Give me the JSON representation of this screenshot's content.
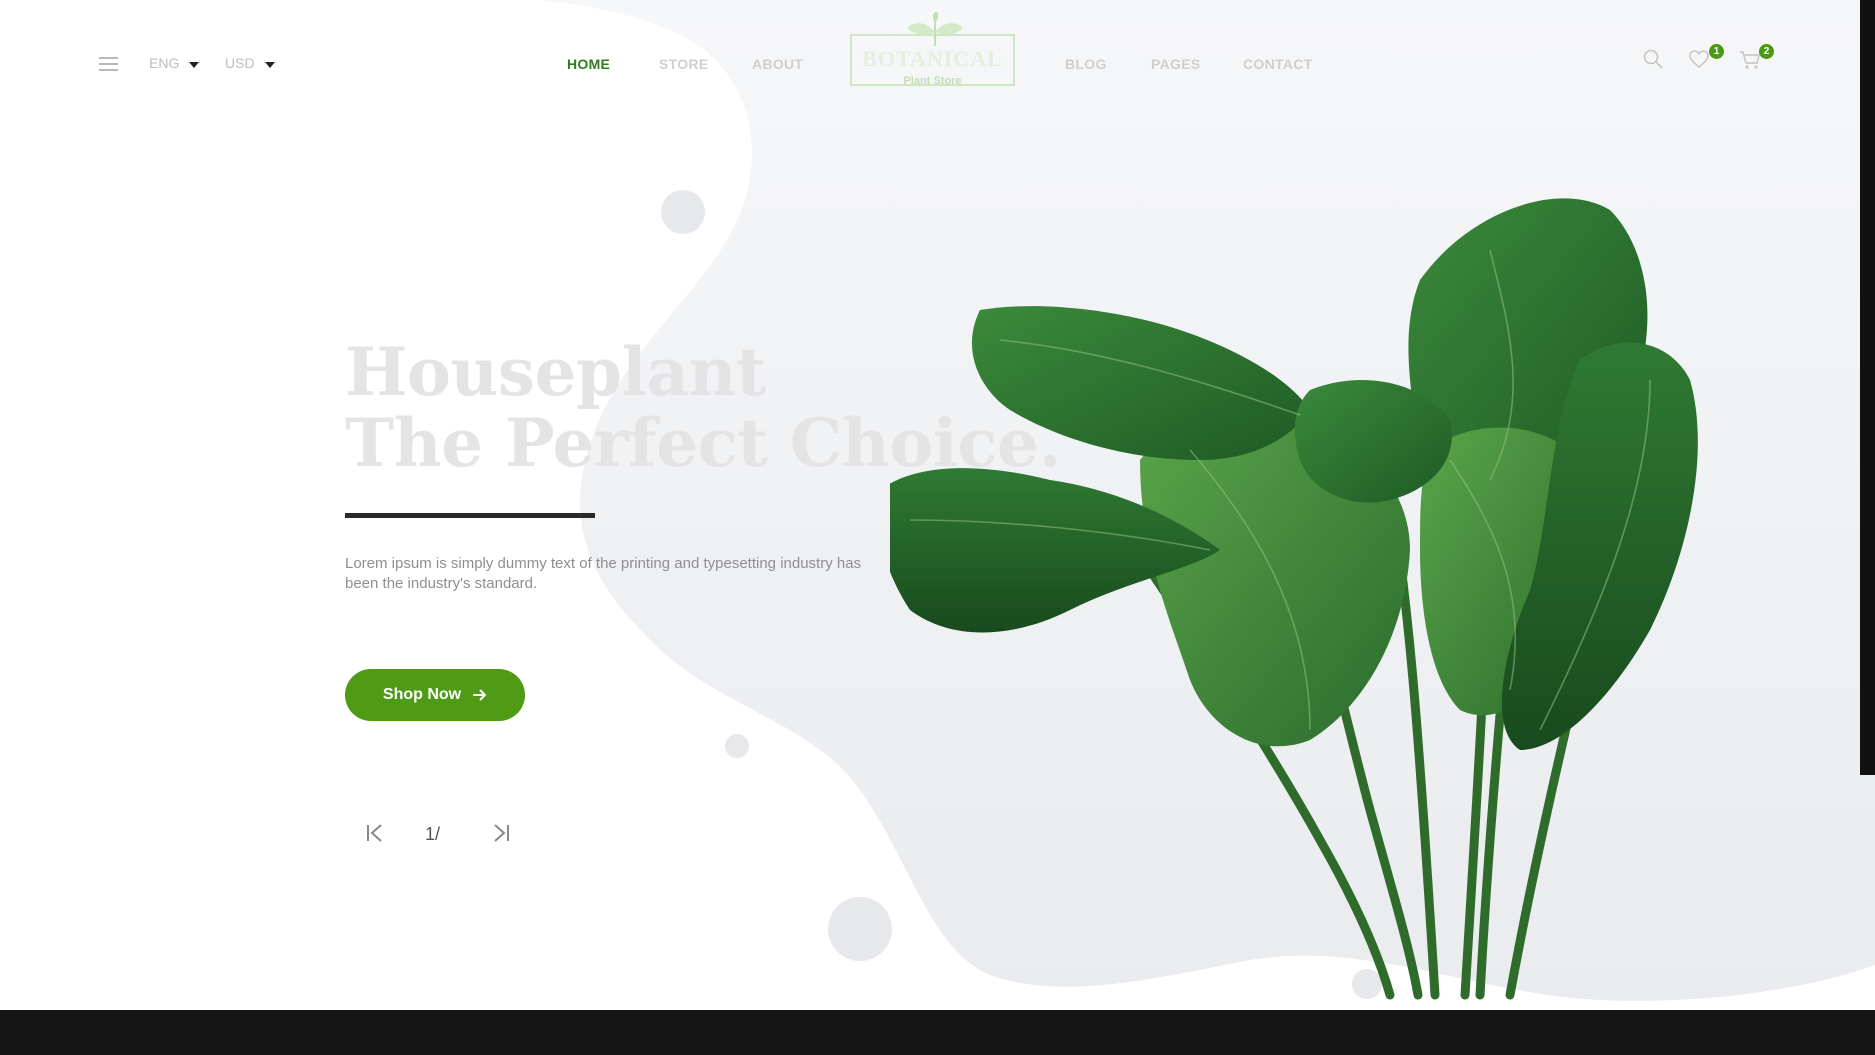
{
  "header": {
    "language": "ENG",
    "currency": "USD",
    "nav": {
      "home": "HOME",
      "store": "STORE",
      "about": "ABOUT",
      "blog": "BLOG",
      "pages": "PAGES",
      "contact": "CONTACT"
    },
    "logo": {
      "word": "BOTANICAL",
      "sub": "Plant Store"
    },
    "wishlist_count": "1",
    "cart_count": "2",
    "icons": [
      "menu-icon",
      "search-icon",
      "heart-icon",
      "cart-icon"
    ]
  },
  "hero": {
    "title_line1": "Houseplant",
    "title_line2": "The Perfect Choice.",
    "description": "Lorem ipsum is simply dummy text of the printing and typesetting industry has been the industry's standard.",
    "cta_label": "Shop Now",
    "pager_text": "1/"
  },
  "colors": {
    "accent_green": "#4f9b16",
    "active_nav": "#2f7d1c",
    "blob": "#eef0f3",
    "footer_bar": "#141414"
  }
}
